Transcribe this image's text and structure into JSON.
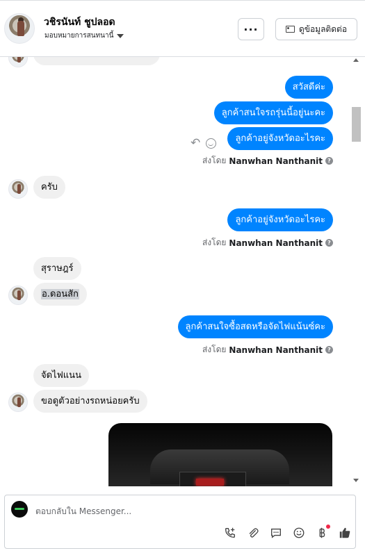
{
  "header": {
    "name": "วชิรนันท์ ชูปลอด",
    "assigned_label": "มอบหมายการสนทนานี้",
    "more_label": "···",
    "contact_label": "ดูข้อมูลติดต่อ"
  },
  "messages": {
    "out_1": "สวัสดีค่ะ",
    "out_2": "ลูกค้าสนใจรถรุ่นนี้อยู่นะคะ",
    "out_3": "ลูกค้าอยู่จังหวัดอะไรคะ",
    "in_1": "ครับ",
    "out_4": "ลูกค้าอยู่จังหวัดอะไรคะ",
    "in_2": "สุราษฎร์",
    "in_3": "อ.ดอนสัก",
    "out_5": "ลูกค้าสนใจซื้อสดหรือจัดไฟแน้นซ์คะ",
    "in_4": "จัดไฟแนน",
    "in_5": "ขอดูตัวอย่างรถหน่อยครับ"
  },
  "sent_by": {
    "prefix": "ส่งโดย",
    "agent": "Nanwhan Nanthanit",
    "info": "?"
  },
  "composer": {
    "placeholder": "ตอบกลับใน Messenger..."
  },
  "colors": {
    "outgoing_bubble": "#0084ff",
    "incoming_bubble": "#f0f0f0",
    "like_icon": "#444444"
  }
}
